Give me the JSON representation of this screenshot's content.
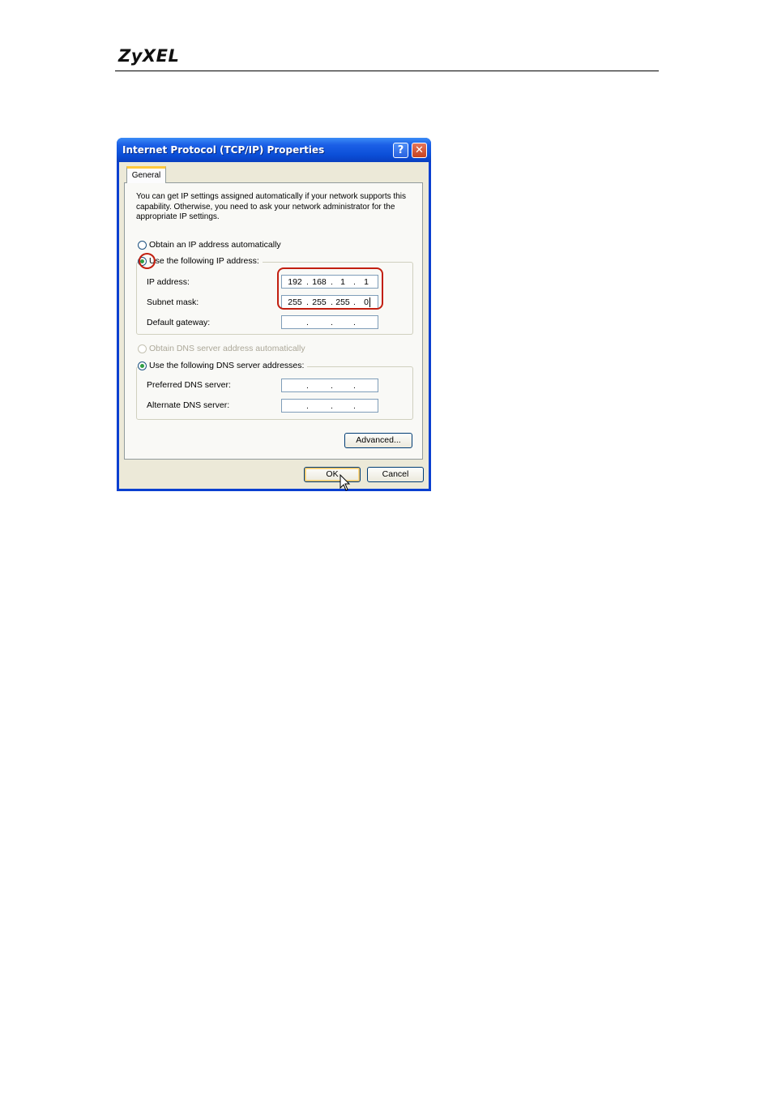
{
  "header": {
    "logo": "ZyXEL"
  },
  "dialog": {
    "title": "Internet Protocol (TCP/IP) Properties",
    "help_glyph": "?",
    "close_glyph": "✕",
    "tabs": [
      {
        "label": "General",
        "selected": true
      }
    ],
    "intro": "You can get IP settings assigned automatically if your network supports this capability. Otherwise, you need to ask your network administrator for the appropriate IP settings.",
    "ip_mode": {
      "auto_label": "Obtain an IP address automatically",
      "manual_label": "Use the following IP address:",
      "selected": "manual"
    },
    "ip_fields": {
      "ip_address_label": "IP address:",
      "ip_address": [
        "192",
        "168",
        "1",
        "1"
      ],
      "subnet_mask_label": "Subnet mask:",
      "subnet_mask": [
        "255",
        "255",
        "255",
        "0"
      ],
      "default_gateway_label": "Default gateway:",
      "default_gateway": [
        "",
        "",
        "",
        ""
      ]
    },
    "dns_mode": {
      "auto_label": "Obtain DNS server address automatically",
      "auto_disabled": true,
      "manual_label": "Use the following DNS server addresses:",
      "selected": "manual"
    },
    "dns_fields": {
      "preferred_label": "Preferred DNS server:",
      "preferred": [
        "",
        "",
        "",
        ""
      ],
      "alternate_label": "Alternate DNS server:",
      "alternate": [
        "",
        "",
        "",
        ""
      ]
    },
    "buttons": {
      "advanced": "Advanced...",
      "ok": "OK",
      "cancel": "Cancel"
    },
    "highlight_color": "#c21f10"
  }
}
